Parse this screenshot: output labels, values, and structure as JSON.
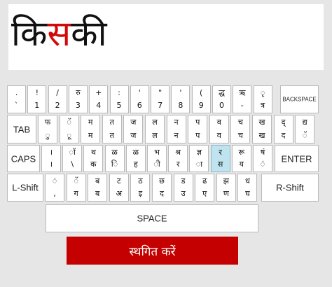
{
  "word": {
    "before": "कि",
    "current": "स",
    "after": "की"
  },
  "keyboard": {
    "row1": [
      {
        "u": ".",
        "l": "`"
      },
      {
        "u": "!",
        "l": "1"
      },
      {
        "u": "/",
        "l": "2"
      },
      {
        "u": "रु",
        "l": "3"
      },
      {
        "u": "+",
        "l": "4"
      },
      {
        "u": ":",
        "l": "5"
      },
      {
        "u": "'",
        "l": "6"
      },
      {
        "u": "\"",
        "l": "7"
      },
      {
        "u": "'",
        "l": "8"
      },
      {
        "u": "(",
        "l": "9"
      },
      {
        "u": "द्ध",
        "l": "0"
      },
      {
        "u": "ऋ",
        "l": "-"
      },
      {
        "u": "ृ",
        "l": "त्र"
      }
    ],
    "backspace": "BACKSPACE",
    "tab": "TAB",
    "row2": [
      {
        "u": "फ",
        "l": "ु"
      },
      {
        "u": "ॅ",
        "l": "ू"
      },
      {
        "u": "म",
        "l": "म"
      },
      {
        "u": "त",
        "l": "त"
      },
      {
        "u": "ज",
        "l": "ज"
      },
      {
        "u": "ल",
        "l": "ल"
      },
      {
        "u": "न",
        "l": "न"
      },
      {
        "u": "प",
        "l": "प"
      },
      {
        "u": "व",
        "l": "व"
      },
      {
        "u": "च",
        "l": "च"
      },
      {
        "u": "ख",
        "l": "ख"
      },
      {
        "u": "द्",
        "l": "द"
      },
      {
        "u": "द्य",
        "l": "ॅ"
      }
    ],
    "caps": "CAPS",
    "row3": [
      {
        "u": "।",
        "l": "।"
      },
      {
        "u": "ॉ",
        "l": "\\"
      },
      {
        "u": "थ",
        "l": "क"
      },
      {
        "u": "ळ",
        "l": "ि"
      },
      {
        "u": "ळ",
        "l": "ह"
      },
      {
        "u": "भ",
        "l": "ी"
      },
      {
        "u": "श्र",
        "l": "र"
      },
      {
        "u": "ज्ञ",
        "l": "ा"
      },
      {
        "u": "र",
        "l": "स"
      },
      {
        "u": "रू",
        "l": "य"
      },
      {
        "u": "षं",
        "l": "ं"
      }
    ],
    "enter": "ENTER",
    "lshift": "L-Shift",
    "row4": [
      {
        "u": "ं",
        "l": ","
      },
      {
        "u": "ॅ",
        "l": "ग"
      },
      {
        "u": "ब",
        "l": "ब"
      },
      {
        "u": "ट",
        "l": "अ"
      },
      {
        "u": "ठ",
        "l": "इ"
      },
      {
        "u": "छ",
        "l": "द"
      },
      {
        "u": "ड",
        "l": "उ"
      },
      {
        "u": "ढ",
        "l": "ए"
      },
      {
        "u": "झ",
        "l": "ण"
      },
      {
        "u": "ध",
        "l": "घ"
      }
    ],
    "rshift": "R-Shift",
    "space": "SPACE"
  },
  "pause_button": "स्थगित करें",
  "colors": {
    "highlight": "#d10a0a",
    "active_key": "#bfe3ef",
    "button": "#c40000"
  }
}
